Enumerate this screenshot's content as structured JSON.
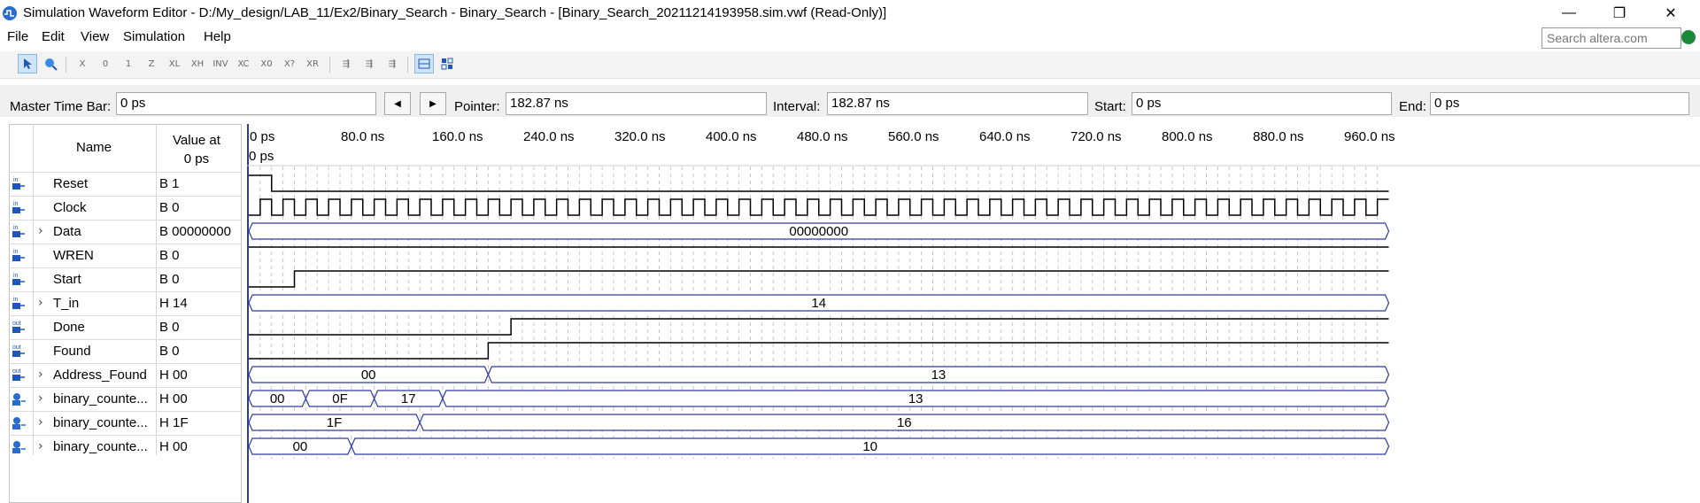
{
  "window": {
    "title": "Simulation Waveform Editor - D:/My_design/LAB_11/Ex2/Binary_Search - Binary_Search - [Binary_Search_20211214193958.sim.vwf (Read-Only)]",
    "minimize": "—",
    "restore": "❐",
    "close": "✕"
  },
  "menu": {
    "file": "File",
    "edit": "Edit",
    "view": "View",
    "simulation": "Simulation",
    "help": "Help",
    "search_placeholder": "Search altera.com"
  },
  "toolbar": {
    "icons": [
      "selection-tool-icon",
      "zoom-tool-icon",
      "force-unknown-icon",
      "force-low-icon",
      "force-high-icon",
      "force-high-impedance-icon",
      "force-weak-low-icon",
      "force-weak-high-icon",
      "invert-icon",
      "count-value-icon",
      "clock-icon",
      "arbitrary-value-icon",
      "random-value-icon",
      "functional-simulation-icon",
      "timing-simulation-icon",
      "netlist-viewer-icon",
      "snap-to-grid-icon",
      "group-icon"
    ]
  },
  "timebar": {
    "master_label": "Master Time Bar:",
    "master_value": "0 ps",
    "prev": "◀",
    "next": "▶",
    "pointer_label": "Pointer:",
    "pointer_value": "182.87 ns",
    "interval_label": "Interval:",
    "interval_value": "182.87 ns",
    "start_label": "Start:",
    "start_value": "0 ps",
    "end_label": "End:",
    "end_value": "0 ps"
  },
  "panel": {
    "name_header": "Name",
    "value_header_line1": "Value at",
    "value_header_line2": "0 ps"
  },
  "time_ticks": [
    "0 ps",
    "80.0 ns",
    "160.0 ns",
    "240.0 ns",
    "320.0 ns",
    "400.0 ns",
    "480.0 ns",
    "560.0 ns",
    "640.0 ns",
    "720.0 ns",
    "800.0 ns",
    "880.0 ns",
    "960.0 ns"
  ],
  "cursor_label": "0 ps",
  "signals": [
    {
      "name": "Reset",
      "value": "B 1",
      "dir": "in",
      "expandable": false,
      "type": "bit",
      "wave": [
        [
          0,
          1
        ],
        [
          20,
          0
        ]
      ]
    },
    {
      "name": "Clock",
      "value": "B 0",
      "dir": "in",
      "expandable": false,
      "type": "clock",
      "period_ns": 20
    },
    {
      "name": "Data",
      "value": "B 00000000",
      "dir": "in",
      "expandable": true,
      "type": "bus",
      "wave": [
        [
          0,
          "00000000"
        ]
      ]
    },
    {
      "name": "WREN",
      "value": "B 0",
      "dir": "in",
      "expandable": false,
      "type": "bit",
      "wave": [
        [
          0,
          1
        ]
      ]
    },
    {
      "name": "Start",
      "value": "B 0",
      "dir": "in",
      "expandable": false,
      "type": "bit",
      "wave": [
        [
          0,
          0
        ],
        [
          40,
          1
        ]
      ]
    },
    {
      "name": "T_in",
      "value": "H 14",
      "dir": "in",
      "expandable": true,
      "type": "bus",
      "wave": [
        [
          0,
          "14"
        ]
      ]
    },
    {
      "name": "Done",
      "value": "B 0",
      "dir": "out",
      "expandable": false,
      "type": "bit",
      "wave": [
        [
          0,
          0
        ],
        [
          230,
          1
        ]
      ]
    },
    {
      "name": "Found",
      "value": "B 0",
      "dir": "out",
      "expandable": false,
      "type": "bit",
      "wave": [
        [
          0,
          0
        ],
        [
          210,
          1
        ]
      ]
    },
    {
      "name": "Address_Found",
      "value": "H 00",
      "dir": "out",
      "expandable": true,
      "type": "bus",
      "wave": [
        [
          0,
          "00"
        ],
        [
          210,
          "13"
        ]
      ]
    },
    {
      "name": "binary_counte...",
      "value": "H 00",
      "dir": "reg",
      "expandable": true,
      "type": "bus",
      "wave": [
        [
          0,
          "00"
        ],
        [
          50,
          "0F"
        ],
        [
          110,
          "17"
        ],
        [
          170,
          "13"
        ]
      ]
    },
    {
      "name": "binary_counte...",
      "value": "H 1F",
      "dir": "reg",
      "expandable": true,
      "type": "bus",
      "wave": [
        [
          0,
          "1F"
        ],
        [
          150,
          "16"
        ]
      ]
    },
    {
      "name": "binary_counte...",
      "value": "H 00",
      "dir": "reg",
      "expandable": true,
      "type": "bus",
      "wave": [
        [
          0,
          "00"
        ],
        [
          90,
          "10"
        ]
      ]
    }
  ],
  "colors": {
    "bus_outline": "#2f3aa3",
    "wave_line": "#000000",
    "grid_dash": "#9a9a9a",
    "icon_in": "#1f57b8",
    "icon_reg": "#2a6bd0"
  }
}
